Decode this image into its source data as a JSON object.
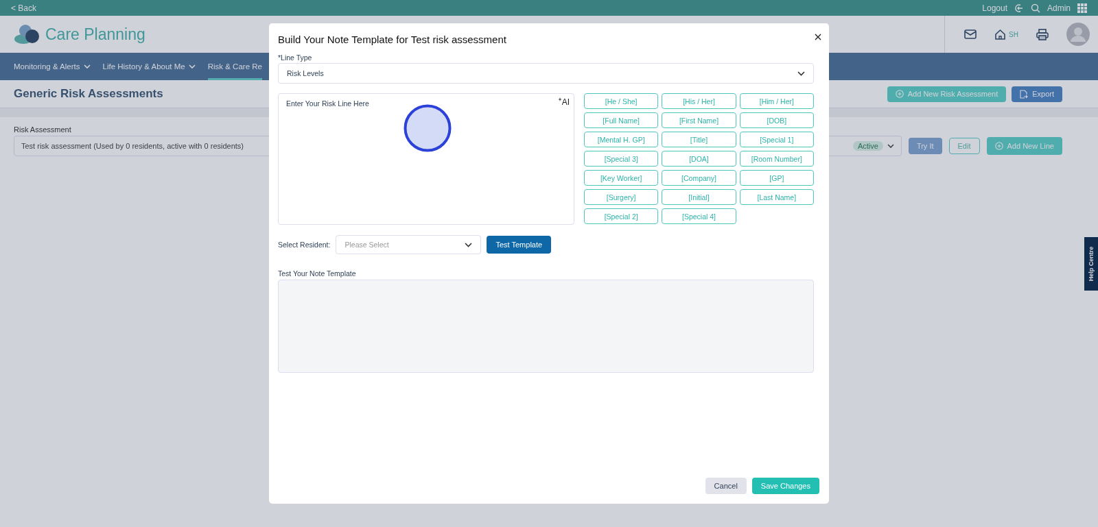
{
  "top_bar": {
    "back": "< Back",
    "logout": "Logout",
    "user": "Admin"
  },
  "header": {
    "app_title": "Care Planning",
    "home_badge": "SH"
  },
  "nav": [
    {
      "label": "Monitoring & Alerts",
      "dropdown": true,
      "selected": false
    },
    {
      "label": "Life History & About Me",
      "dropdown": true,
      "selected": false
    },
    {
      "label": "Risk & Care Re",
      "dropdown": false,
      "selected": true
    }
  ],
  "page": {
    "title": "Generic Risk Assessments",
    "add_button": "Add New Risk Assessment",
    "export_button": "Export",
    "field_label": "Risk Assessment",
    "field_value": "Test risk assessment (Used by 0 residents, active with 0 residents)",
    "status_badge": "Active",
    "try_button": "Try It",
    "edit_button": "Edit",
    "add_line_button": "Add New Line"
  },
  "help_tab": "Help Centre",
  "dialog": {
    "title": "Build Your Note Template for Test risk assessment",
    "line_type_label": "*Line Type",
    "line_type_value": "Risk Levels",
    "editor_placeholder": "Enter Your Risk Line Here",
    "ai_label": "AI",
    "tokens": [
      "[He / She]",
      "[His / Her]",
      "[Him / Her]",
      "[Full Name]",
      "[First Name]",
      "[DOB]",
      "[Mental H. GP]",
      "[Title]",
      "[Special 1]",
      "[Special 3]",
      "[DOA]",
      "[Room Number]",
      "[Key Worker]",
      "[Company]",
      "[GP]",
      "[Surgery]",
      "[Initial]",
      "[Last Name]",
      "[Special 2]",
      "[Special 4]"
    ],
    "resident_label": "Select Resident:",
    "resident_placeholder": "Please Select",
    "test_button": "Test Template",
    "test_label": "Test Your Note Template",
    "cancel_button": "Cancel",
    "save_button": "Save Changes"
  }
}
